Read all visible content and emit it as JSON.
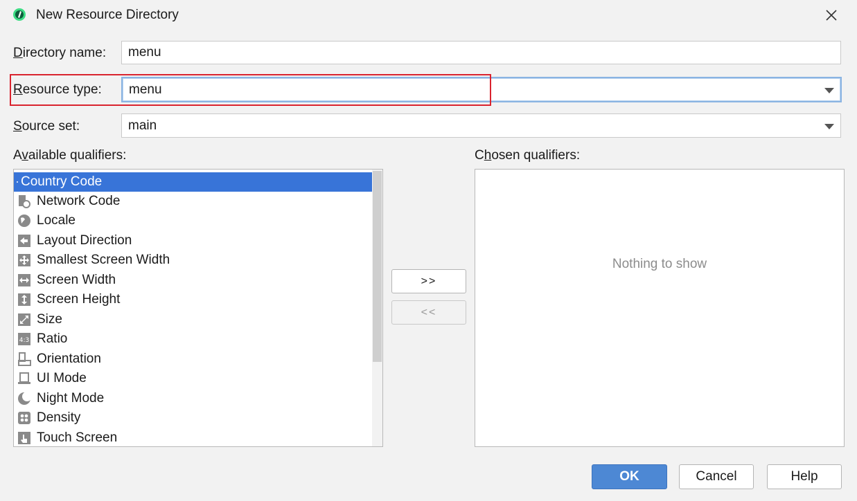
{
  "window": {
    "title": "New Resource Directory",
    "icon": "android-studio-icon",
    "close_icon": "close-icon"
  },
  "form": {
    "directory_name": {
      "label_first": "D",
      "label_rest": "irectory name:",
      "value": "menu"
    },
    "resource_type": {
      "label_first": "R",
      "label_rest": "esource type:",
      "value": "menu"
    },
    "source_set": {
      "label_first": "S",
      "label_rest": "ource set:",
      "value": "main"
    }
  },
  "available": {
    "label_pre": "A",
    "label_ul": "v",
    "label_post": "ailable qualifiers:",
    "items": [
      {
        "label": "Country Code",
        "icon": "country-code-icon",
        "selected": true
      },
      {
        "label": "Network Code",
        "icon": "network-code-icon"
      },
      {
        "label": "Locale",
        "icon": "globe-icon"
      },
      {
        "label": "Layout Direction",
        "icon": "layout-direction-icon"
      },
      {
        "label": "Smallest Screen Width",
        "icon": "smallest-width-icon"
      },
      {
        "label": "Screen Width",
        "icon": "screen-width-icon"
      },
      {
        "label": "Screen Height",
        "icon": "screen-height-icon"
      },
      {
        "label": "Size",
        "icon": "size-icon"
      },
      {
        "label": "Ratio",
        "icon": "ratio-icon"
      },
      {
        "label": "Orientation",
        "icon": "orientation-icon"
      },
      {
        "label": "UI Mode",
        "icon": "ui-mode-icon"
      },
      {
        "label": "Night Mode",
        "icon": "night-mode-icon"
      },
      {
        "label": "Density",
        "icon": "density-icon"
      },
      {
        "label": "Touch Screen",
        "icon": "touch-screen-icon"
      }
    ]
  },
  "chosen": {
    "label_pre": "C",
    "label_ul": "h",
    "label_post": "osen qualifiers:",
    "empty_text": "Nothing to show"
  },
  "transfer": {
    "add_label": ">>",
    "remove_label": "<<"
  },
  "buttons": {
    "ok": "OK",
    "cancel": "Cancel",
    "help": "Help"
  },
  "colors": {
    "selection": "#3874d8",
    "ok_button": "#4d88d4",
    "highlight_box": "#d9232e"
  }
}
